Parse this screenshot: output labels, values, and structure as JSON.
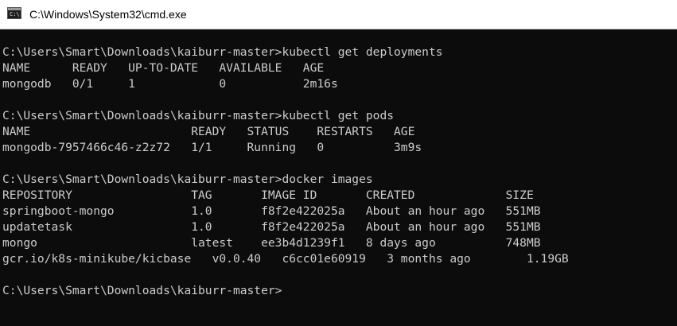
{
  "window": {
    "title": "C:\\Windows\\System32\\cmd.exe",
    "icon": "cmd-icon",
    "icon_text": "C:\\"
  },
  "console": {
    "lines": [
      "C:\\Users\\Smart\\Downloads\\kaiburr-master>kubectl get deployments",
      "NAME      READY   UP-TO-DATE   AVAILABLE   AGE",
      "mongodb   0/1     1            0           2m16s",
      "",
      "C:\\Users\\Smart\\Downloads\\kaiburr-master>kubectl get pods",
      "NAME                       READY   STATUS    RESTARTS   AGE",
      "mongodb-7957466c46-z2z72   1/1     Running   0          3m9s",
      "",
      "C:\\Users\\Smart\\Downloads\\kaiburr-master>docker images",
      "REPOSITORY                 TAG       IMAGE ID       CREATED             SIZE",
      "springboot-mongo           1.0       f8f2e422025a   About an hour ago   551MB",
      "updatetask                 1.0       f8f2e422025a   About an hour ago   551MB",
      "mongo                      latest    ee3b4d1239f1   8 days ago          748MB",
      "gcr.io/k8s-minikube/kicbase   v0.0.40   c6cc01e60919   3 months ago        1.19GB",
      "",
      "C:\\Users\\Smart\\Downloads\\kaiburr-master>"
    ]
  },
  "colors": {
    "console_background": "#0c0c0c",
    "console_text": "#cccccc",
    "titlebar_background": "#ffffff"
  }
}
